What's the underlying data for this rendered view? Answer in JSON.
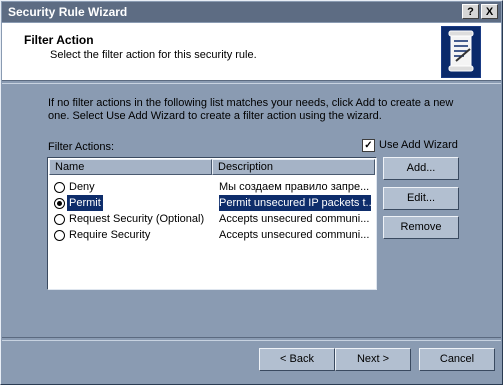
{
  "window": {
    "title": "Security Rule Wizard",
    "help_label": "?",
    "close_label": "X"
  },
  "header": {
    "title": "Filter Action",
    "subtitle": "Select the filter action for this security rule."
  },
  "intro_text": "If no filter actions in the following list matches your needs, click Add to create a new one. Select Use Add Wizard to create a filter action using the wizard.",
  "filter_actions_label": "Filter Actions:",
  "use_add_wizard": {
    "label": "Use Add Wizard",
    "checked": true,
    "mark": "✓"
  },
  "list": {
    "columns": [
      "Name",
      "Description"
    ],
    "rows": [
      {
        "name": "Deny",
        "description": "Мы создаем правило запре...",
        "selected": false
      },
      {
        "name": "Permit",
        "description": "Permit unsecured IP packets t...",
        "selected": true
      },
      {
        "name": "Request Security (Optional)",
        "description": "Accepts unsecured communi...",
        "selected": false
      },
      {
        "name": "Require Security",
        "description": "Accepts unsecured communi...",
        "selected": false
      }
    ]
  },
  "side_buttons": {
    "add": "Add...",
    "edit": "Edit...",
    "remove": "Remove"
  },
  "footer": {
    "back": "< Back",
    "next": "Next >",
    "cancel": "Cancel"
  }
}
